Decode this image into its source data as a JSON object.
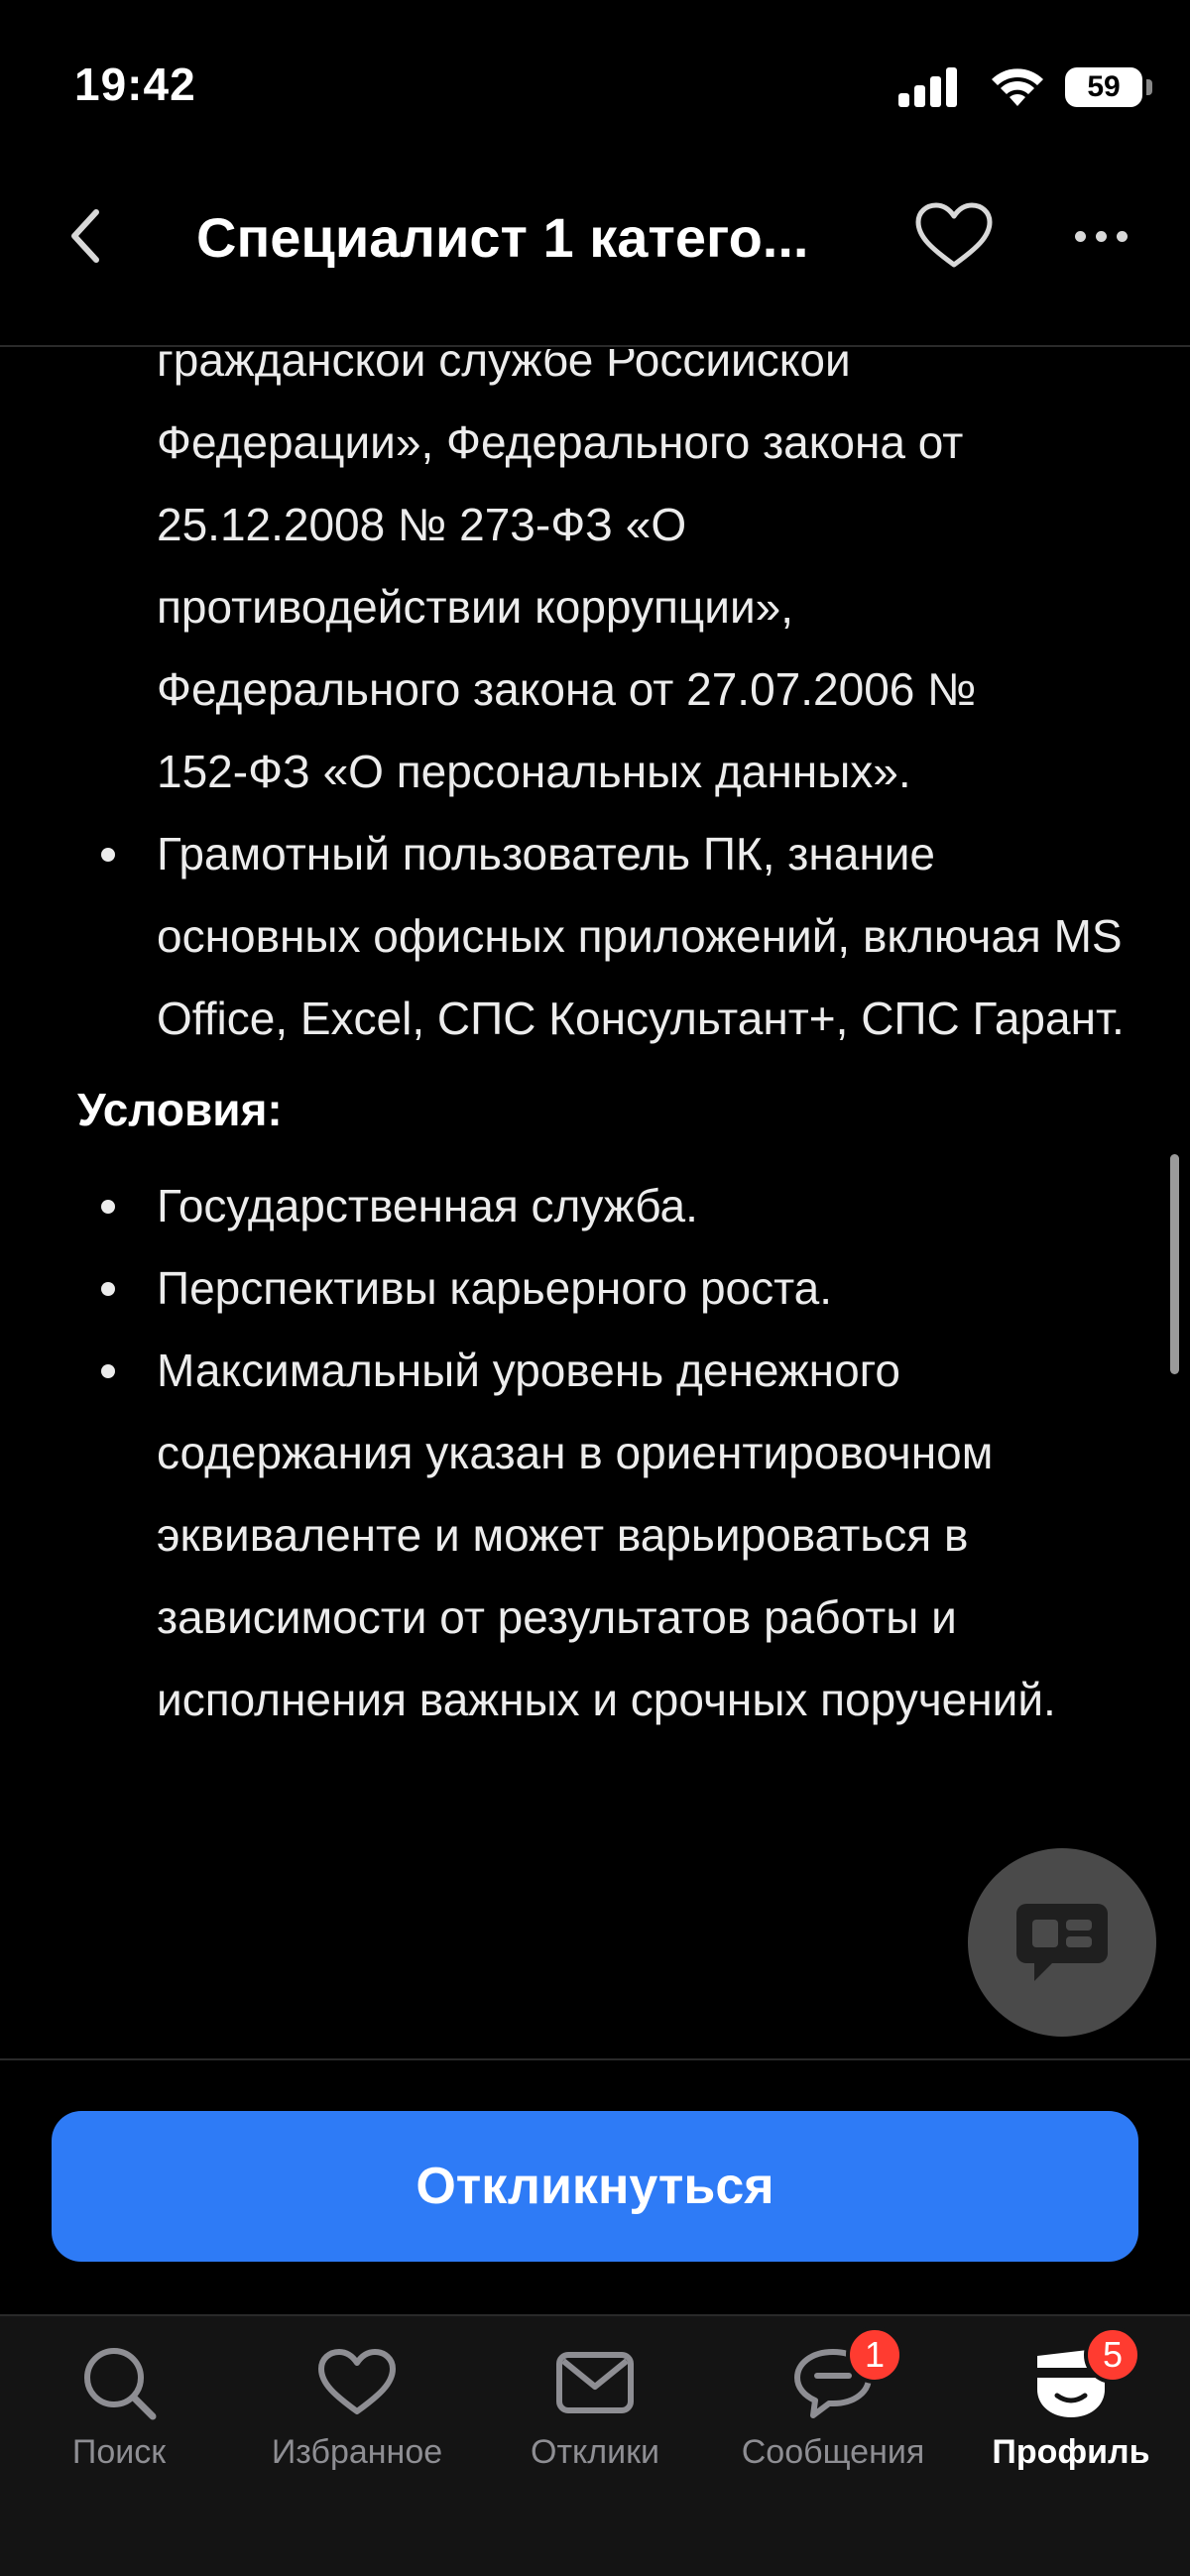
{
  "status_bar": {
    "time": "19:42",
    "battery": "59"
  },
  "header": {
    "title": "Специалист 1 катего..."
  },
  "requirements_continued": [
    "гражданской службе Российской",
    "Федерации», Федерального закона от",
    "25.12.2008 № 273-ФЗ «О",
    "противодействии коррупции»,",
    "Федерального закона от 27.07.2006 №",
    "152-ФЗ «О персональных данных»."
  ],
  "requirements_last": "Грамотный пользователь ПК, знание основных офисных приложений, включая MS Office, Excel, СПС Консультант+, СПС Гарант.",
  "conditions": {
    "heading": "Условия:",
    "items": [
      "Государственная служба.",
      "Перспективы карьерного роста.",
      "Максимальный уровень денежного содержания указан в ориентировочном эквиваленте и может варьироваться в зависимости от результатов работы и исполнения важных и срочных поручений."
    ]
  },
  "action": {
    "respond_label": "Откликнуться"
  },
  "tabs": [
    {
      "label": "Поиск",
      "icon": "search-icon"
    },
    {
      "label": "Избранное",
      "icon": "heart-icon"
    },
    {
      "label": "Отклики",
      "icon": "envelope-icon"
    },
    {
      "label": "Сообщения",
      "icon": "chat-bubble-icon",
      "badge": "1"
    },
    {
      "label": "Профиль",
      "icon": "profile-avatar-icon",
      "badge": "5",
      "active": true
    }
  ],
  "colors": {
    "accent": "#2e7bf6",
    "badge": "#ff3b30",
    "background": "#000000"
  }
}
